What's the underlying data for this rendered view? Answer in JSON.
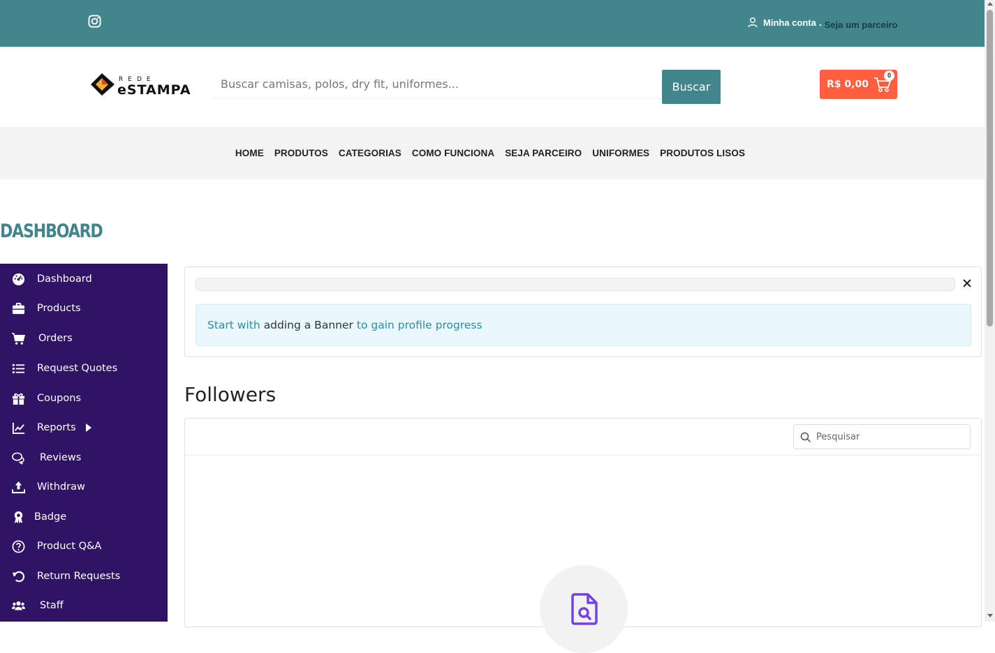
{
  "top_bar": {
    "account_label": "Minha conta",
    "separator": ".",
    "partner_label": "Seja um parceiro"
  },
  "header": {
    "logo_top": "REDE",
    "logo_main": "eSTAMPA",
    "search_placeholder": "Buscar camisas, polos, dry fit, uniformes...",
    "search_button": "Buscar",
    "cart_total": "R$ 0,00",
    "cart_count": "0"
  },
  "nav": {
    "items": [
      "HOME",
      "PRODUTOS",
      "CATEGORIAS",
      "COMO FUNCIONA",
      "SEJA PARCEIRO",
      "UNIFORMES",
      "PRODUTOS LISOS"
    ]
  },
  "page_title": "DASHBOARD",
  "sidebar": {
    "items": [
      {
        "label": "Dashboard",
        "icon": "dashboard-icon"
      },
      {
        "label": "Products",
        "icon": "briefcase-icon"
      },
      {
        "label": "Orders",
        "icon": "cart-icon"
      },
      {
        "label": "Request Quotes",
        "icon": "list-icon"
      },
      {
        "label": "Coupons",
        "icon": "gift-icon"
      },
      {
        "label": "Reports",
        "icon": "chart-line-icon"
      },
      {
        "label": "Reviews",
        "icon": "comments-icon"
      },
      {
        "label": "Withdraw",
        "icon": "upload-icon"
      },
      {
        "label": "Badge",
        "icon": "award-icon"
      },
      {
        "label": "Product Q&A",
        "icon": "question-icon"
      },
      {
        "label": "Return Requests",
        "icon": "undo-icon"
      },
      {
        "label": "Staff",
        "icon": "users-icon"
      }
    ]
  },
  "progress": {
    "alert_link_1": "Start with",
    "alert_plain": "adding a Banner",
    "alert_link_2": "to gain profile progress"
  },
  "followers": {
    "title": "Followers",
    "search_placeholder": "Pesquisar"
  },
  "colors": {
    "teal": "#41868c",
    "sidebar_bg": "#2f1466",
    "cart_orange": "#ff5f3f",
    "link_blue": "#2d8ba8"
  }
}
